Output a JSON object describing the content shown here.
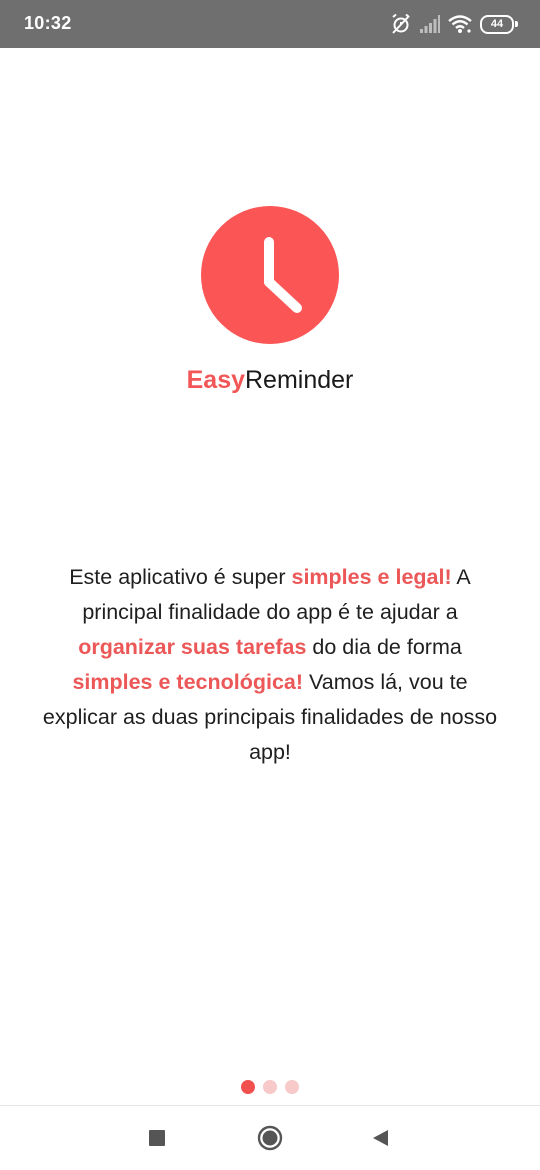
{
  "status_bar": {
    "time": "10:32",
    "battery_level": "44",
    "icons": [
      "alarm-off-icon",
      "signal-icon",
      "wifi-icon",
      "battery-icon"
    ]
  },
  "app": {
    "name_accent": "Easy",
    "name_rest": "Reminder",
    "logo_icon": "clock-icon",
    "colors": {
      "brand": "#fc5555",
      "accent_text": "#f25656",
      "highlight_text": "#ec5757",
      "dot_inactive": "#f7c9c9",
      "dot_active": "#f24f4f"
    }
  },
  "description": {
    "part1": "Este aplicativo é super ",
    "highlight1": "simples e legal!",
    "part2": " A principal finalidade do app é te ajudar a ",
    "highlight2": "organizar suas tarefas",
    "part3": " do dia de forma ",
    "highlight3": "simples e tecnológica!",
    "part4": " Vamos lá, vou te explicar as duas principais finalidades de nosso app!"
  },
  "pager": {
    "total": 3,
    "current": 1
  },
  "nav_bar": {
    "icons": [
      "recent-apps-icon",
      "home-icon",
      "back-icon"
    ]
  }
}
